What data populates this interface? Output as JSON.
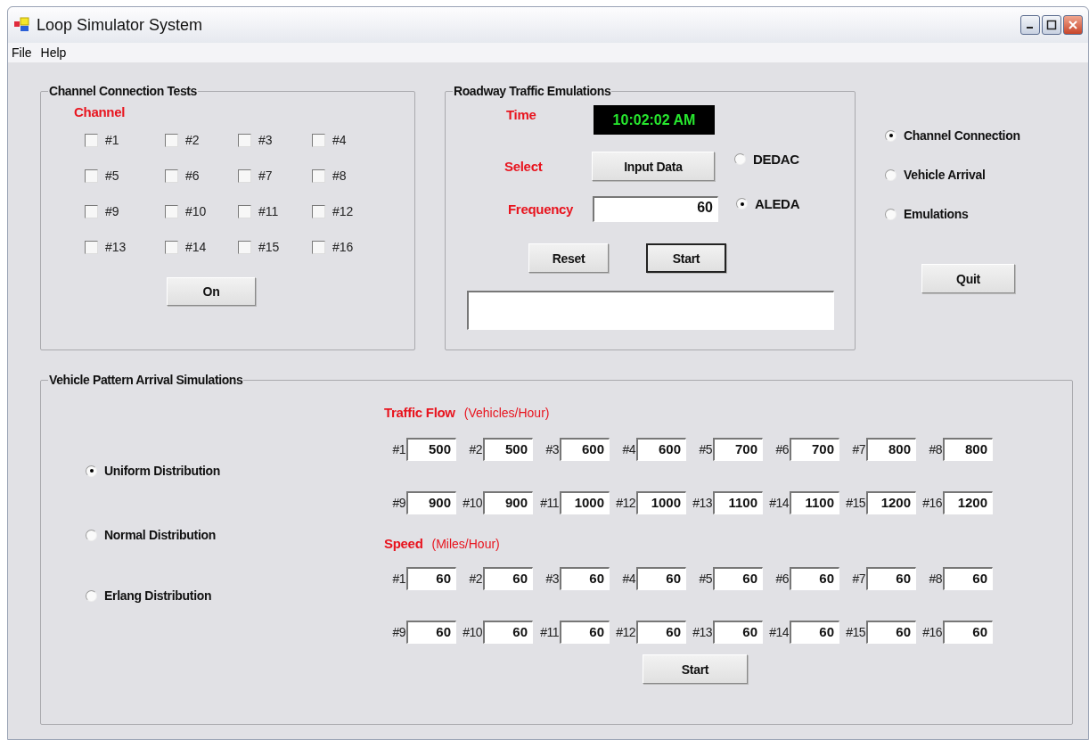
{
  "window": {
    "title": "Loop Simulator System"
  },
  "menu": [
    {
      "label": "File"
    },
    {
      "label": "Help"
    }
  ],
  "channel_tests": {
    "title": "Channel Connection Tests",
    "heading": "Channel",
    "channels": [
      {
        "label": "#1",
        "checked": false
      },
      {
        "label": "#2",
        "checked": false
      },
      {
        "label": "#3",
        "checked": false
      },
      {
        "label": "#4",
        "checked": false
      },
      {
        "label": "#5",
        "checked": false
      },
      {
        "label": "#6",
        "checked": false
      },
      {
        "label": "#7",
        "checked": false
      },
      {
        "label": "#8",
        "checked": false
      },
      {
        "label": "#9",
        "checked": false
      },
      {
        "label": "#10",
        "checked": false
      },
      {
        "label": "#11",
        "checked": false
      },
      {
        "label": "#12",
        "checked": false
      },
      {
        "label": "#13",
        "checked": false
      },
      {
        "label": "#14",
        "checked": false
      },
      {
        "label": "#15",
        "checked": false
      },
      {
        "label": "#16",
        "checked": false
      }
    ],
    "button": "On"
  },
  "roadway": {
    "title": "Roadway Traffic Emulations",
    "time_label": "Time",
    "time": "10:02:02 AM",
    "select_label": "Select",
    "input_button": "Input Data",
    "frequency_label": "Frequency",
    "frequency": "60",
    "sources": [
      {
        "label": "DEDAC",
        "selected": false
      },
      {
        "label": "ALEDA",
        "selected": true
      }
    ],
    "buttons": [
      {
        "label": "Reset",
        "default": false
      },
      {
        "label": "Start",
        "default": true
      }
    ]
  },
  "modes": [
    {
      "label": "Channel Connection",
      "selected": true
    },
    {
      "label": "Vehicle Arrival",
      "selected": false
    },
    {
      "label": "Emulations",
      "selected": false
    }
  ],
  "quit_button": "Quit",
  "vehicle": {
    "title": "Vehicle Pattern Arrival Simulations",
    "distributions": [
      {
        "label": "Uniform Distribution",
        "selected": true
      },
      {
        "label": "Normal Distribution",
        "selected": false
      },
      {
        "label": "Erlang Distribution",
        "selected": false
      }
    ],
    "flow_heading": "Traffic Flow",
    "flow_unit": "(Vehicles/Hour)",
    "flow": [
      {
        "label": "#1",
        "value": "500"
      },
      {
        "label": "#2",
        "value": "500"
      },
      {
        "label": "#3",
        "value": "600"
      },
      {
        "label": "#4",
        "value": "600"
      },
      {
        "label": "#5",
        "value": "700"
      },
      {
        "label": "#6",
        "value": "700"
      },
      {
        "label": "#7",
        "value": "800"
      },
      {
        "label": "#8",
        "value": "800"
      },
      {
        "label": "#9",
        "value": "900"
      },
      {
        "label": "#10",
        "value": "900"
      },
      {
        "label": "#11",
        "value": "1000"
      },
      {
        "label": "#12",
        "value": "1000"
      },
      {
        "label": "#13",
        "value": "1100"
      },
      {
        "label": "#14",
        "value": "1100"
      },
      {
        "label": "#15",
        "value": "1200"
      },
      {
        "label": "#16",
        "value": "1200"
      }
    ],
    "speed_heading": "Speed",
    "speed_unit": "(Miles/Hour)",
    "speed": [
      {
        "label": "#1",
        "value": "60"
      },
      {
        "label": "#2",
        "value": "60"
      },
      {
        "label": "#3",
        "value": "60"
      },
      {
        "label": "#4",
        "value": "60"
      },
      {
        "label": "#5",
        "value": "60"
      },
      {
        "label": "#6",
        "value": "60"
      },
      {
        "label": "#7",
        "value": "60"
      },
      {
        "label": "#8",
        "value": "60"
      },
      {
        "label": "#9",
        "value": "60"
      },
      {
        "label": "#10",
        "value": "60"
      },
      {
        "label": "#11",
        "value": "60"
      },
      {
        "label": "#12",
        "value": "60"
      },
      {
        "label": "#13",
        "value": "60"
      },
      {
        "label": "#14",
        "value": "60"
      },
      {
        "label": "#15",
        "value": "60"
      },
      {
        "label": "#16",
        "value": "60"
      }
    ],
    "start_button": "Start"
  }
}
